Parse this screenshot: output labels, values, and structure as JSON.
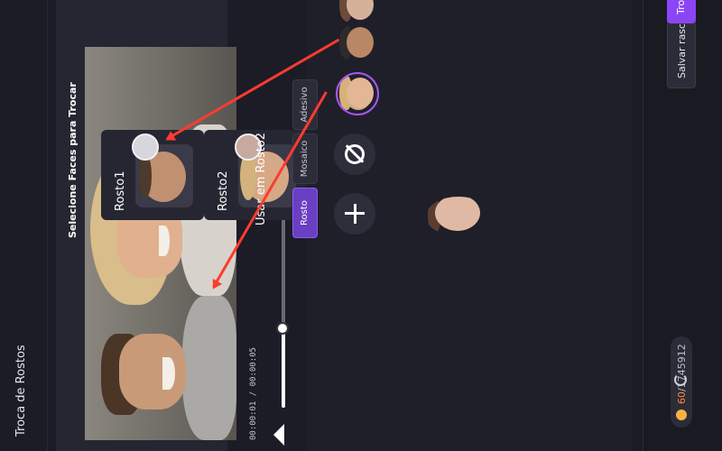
{
  "app": {
    "title": "Troca de Rostos"
  },
  "player": {
    "time": "00:00:01 / 00:00:05",
    "progress": 0.4
  },
  "faces": {
    "heading": "Selecione Faces para Trocar",
    "rows": [
      {
        "label": "Rosto1"
      },
      {
        "label": "Rosto2"
      }
    ],
    "use_in": "Usar em Rosto2",
    "modes": [
      "Rosto",
      "Mosaico",
      "Adesivo"
    ],
    "active_mode": "Rosto"
  },
  "toolbar": {
    "save_draft": "Salvar rascunho",
    "swap": "Troca de",
    "credits_used": "60",
    "credits_total": "/1745912"
  },
  "colors": {
    "accent": "#8b45f5",
    "annotation_arrow": "#ff3b30"
  }
}
